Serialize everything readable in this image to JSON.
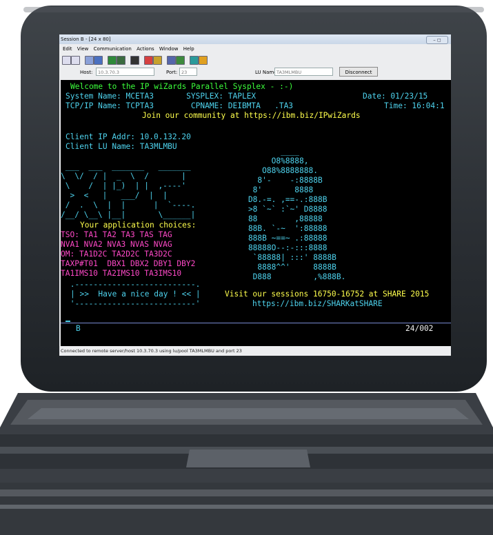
{
  "window": {
    "title": "Session B - [24 x 80]",
    "controls": "– ◻"
  },
  "menu": [
    "Edit",
    "View",
    "Communication",
    "Actions",
    "Window",
    "Help"
  ],
  "toolbar_icons": [
    "copy-icon",
    "paste-icon",
    "send-icon",
    "receive-icon",
    "screen-icon",
    "display-icon",
    "macro-icon",
    "record-icon",
    "play-icon",
    "stop-icon",
    "keyboard-icon",
    "color-icon",
    "print-icon"
  ],
  "connection": {
    "host_label": "Host:",
    "host_value": "10.3.70.3",
    "port_label": "Port:",
    "port_value": "23",
    "lu_label": "LU Name:",
    "lu_value": "TA3MLMBU",
    "disconnect_label": "Disconnect"
  },
  "terminal": {
    "welcome": "Welcome to the IP wiZards Parallel Sysplex - :-)",
    "system_line": "System Name: MCETA3       SYSPLEX: TAPLEX",
    "date": "Date: 01/23/15",
    "tcpip_line": "TCP/IP Name: TCPTA3        CPNAME: DEIBMTA   .TA3",
    "time": "Time: 16:04:1",
    "community": "Join our community at https://ibm.biz/IPwiZards",
    "client_ip": "Client IP Addr: 10.0.132.20",
    "client_lu": "Client LU Name: TA3MLMBU",
    "logo_lines": [
      " ___  ___  _______   _______",
      "\\  \\/  / |  _  \\  /       |",
      " \\    /  | |_)  | |  ,----'",
      "  >  <   |   ___/  |  |",
      " /  .  \\  |  |      |  `----.",
      "/__/ \\__\\ |__|       \\______|"
    ],
    "art_lines": [
      "           ____",
      "         O8%8888,",
      "       O88%8888888.",
      "      8'-    -:8888B",
      "     8'       8888",
      "    D8.-=. ,==-.:888B",
      "    >8 `~` :`~' D8888",
      "    88        ,88888",
      "    88B. `-~  ':88888",
      "    888B ~==~ .:88888",
      "    88888O--:-:::8888",
      "     `88888| :::' 8888B",
      "      8888^^'     8888B",
      "     D888         ,%888B."
    ],
    "choices_title": "Your application choices:",
    "choices": [
      "TSO: TA1 TA2 TA3 TAS TAG",
      "NVA1 NVA2 NVA3 NVAS NVAG",
      "OM: TA1D2C TA2D2C TA3D2C",
      "TAXP#T01  DBX1 DBX2 DBY1 DBY2",
      "TA1IMS10 TA2IMS10 TA3IMS10"
    ],
    "box_top": " .--------------------------.",
    "nice_day": "| >>  Have a nice day ! << |",
    "box_bottom": " '--------------------------'",
    "visit": "Visit our sessions 16750-16752 at SHARE 2015",
    "share_url": "https://ibm.biz/SHARKatSHARE",
    "oia_session": "B",
    "oia_position": "24/002"
  },
  "status": "Connected to remote server/host 10.3.70.3 using lu/pool TA3MLMBU and port 23",
  "colors": {
    "green": "#3cff3c",
    "cyan": "#4ed3ee",
    "yellow": "#ffff4d",
    "magenta": "#ff49c8",
    "bezel": "#2a2e33"
  }
}
